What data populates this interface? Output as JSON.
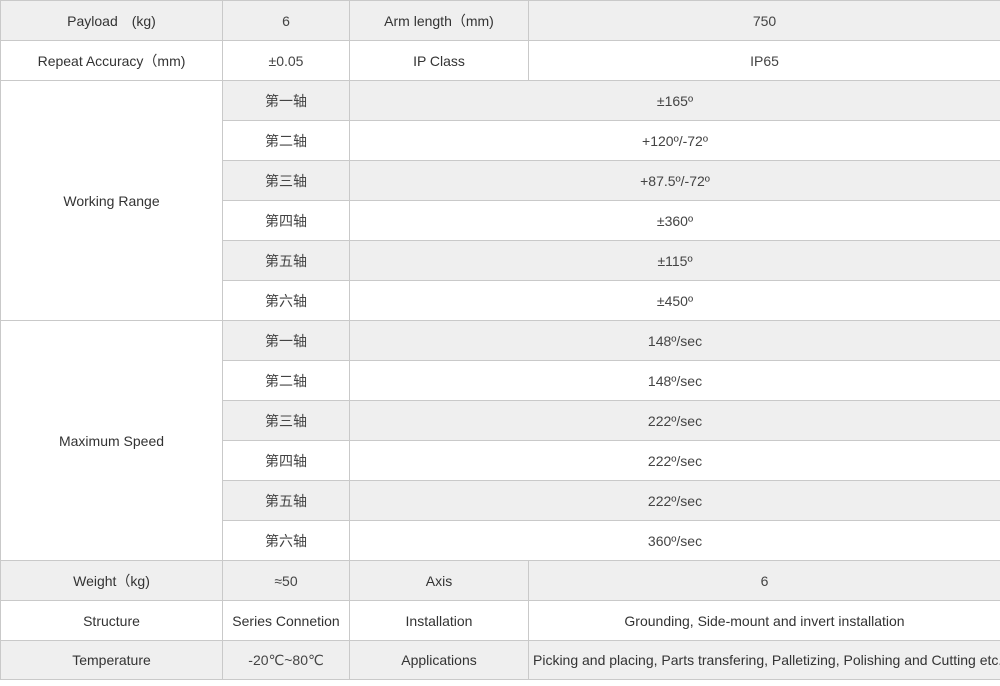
{
  "spec": {
    "payload_label": "Payload　(kg)",
    "payload_value": "6",
    "arm_length_label": "Arm length（mm)",
    "arm_length_value": "750",
    "repeat_accuracy_label": "Repeat Accuracy（mm)",
    "repeat_accuracy_value": "±0.05",
    "ip_class_label": "IP Class",
    "ip_class_value": "IP65",
    "working_range": {
      "label": "Working Range",
      "axes": [
        {
          "name": "第一轴",
          "value": "±165º"
        },
        {
          "name": "第二轴",
          "value": "+120º/-72º"
        },
        {
          "name": "第三轴",
          "value": "+87.5º/-72º"
        },
        {
          "name": "第四轴",
          "value": "±360º"
        },
        {
          "name": "第五轴",
          "value": "±115º"
        },
        {
          "name": "第六轴",
          "value": "±450º"
        }
      ]
    },
    "maximum_speed": {
      "label": "Maximum Speed",
      "axes": [
        {
          "name": "第一轴",
          "value": "148º/sec"
        },
        {
          "name": "第二轴",
          "value": "148º/sec"
        },
        {
          "name": "第三轴",
          "value": "222º/sec"
        },
        {
          "name": "第四轴",
          "value": "222º/sec"
        },
        {
          "name": "第五轴",
          "value": "222º/sec"
        },
        {
          "name": "第六轴",
          "value": "360º/sec"
        }
      ]
    },
    "weight_label": "Weight（kg)",
    "weight_value": "≈50",
    "axis_label": "Axis",
    "axis_value": "6",
    "structure_label": "Structure",
    "structure_value": "Series Connetion",
    "installation_label": "Installation",
    "installation_value": "Grounding,  Side-mount and invert installation",
    "temperature_label": "Temperature",
    "temperature_value": "-20℃~80℃",
    "applications_label": "Applications",
    "applications_value": "Picking and placing,  Parts transfering,  Palletizing, Polishing and Cutting etc."
  }
}
